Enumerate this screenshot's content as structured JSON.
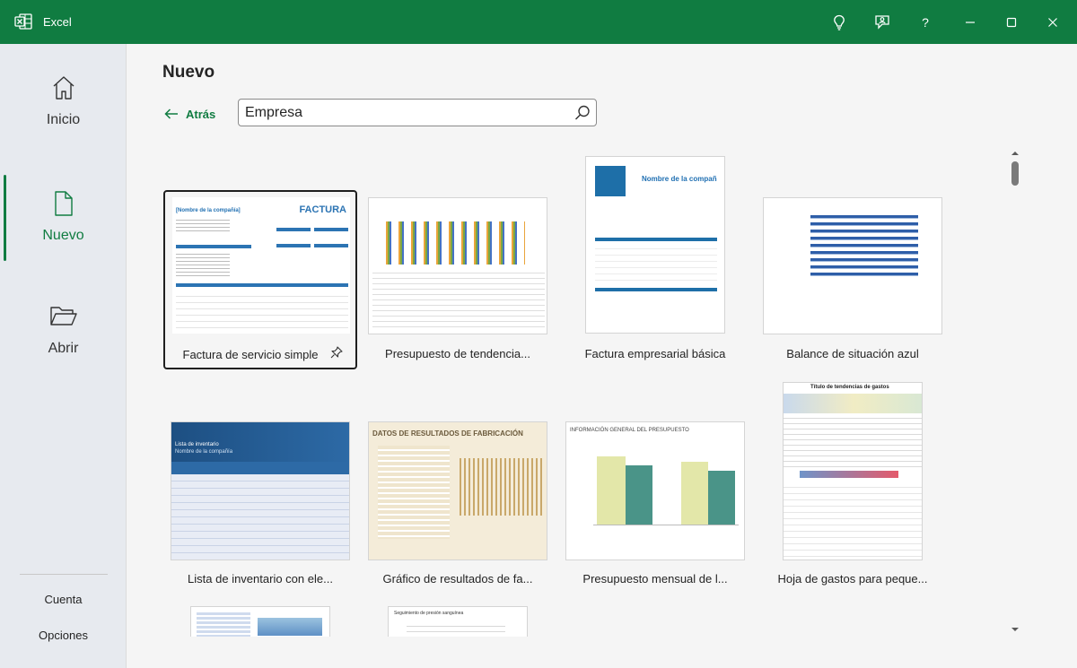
{
  "window": {
    "app_title": "Excel"
  },
  "titlebar": {
    "buttons": [
      "lightbulb-icon",
      "coauthor-icon",
      "help-icon",
      "minimize-icon",
      "maximize-icon",
      "close-icon"
    ],
    "help_label": "?"
  },
  "sidebar": {
    "items": [
      {
        "label": "Inicio",
        "icon": "home-icon"
      },
      {
        "label": "Nuevo",
        "icon": "new-document-icon",
        "active": true
      },
      {
        "label": "Abrir",
        "icon": "folder-open-icon"
      }
    ],
    "bottom": [
      {
        "label": "Cuenta"
      },
      {
        "label": "Opciones"
      }
    ]
  },
  "main": {
    "title": "Nuevo",
    "back_label": "Atrás",
    "search": {
      "value": "Empresa"
    }
  },
  "templates": [
    {
      "label": "Factura de servicio simple",
      "selected": true,
      "thumb_text": {
        "company": "[Nombre de la compañía]",
        "heading": "FACTURA"
      }
    },
    {
      "label": "Presupuesto de tendencia..."
    },
    {
      "label": "Factura empresarial básica",
      "thumb_text": {
        "heading": "Nombre de la compañ"
      }
    },
    {
      "label": "Balance de situación azul"
    },
    {
      "label": "Lista de inventario con ele...",
      "thumb_text": {
        "title": "Lista de inventario",
        "subtitle": "Nombre de la compañía"
      }
    },
    {
      "label": "Gráfico de resultados de fa...",
      "thumb_text": {
        "heading": "DATOS DE RESULTADOS DE FABRICACIÓN"
      }
    },
    {
      "label": "Presupuesto mensual de l...",
      "thumb_text": {
        "heading": "INFORMACIÓN GENERAL DEL PRESUPUESTO"
      }
    },
    {
      "label": "Hoja de gastos para peque...",
      "thumb_text": {
        "heading": "Título de tendencias de gastos"
      }
    },
    {
      "label": ""
    },
    {
      "label": "",
      "thumb_text": {
        "heading": "Seguimiento de presión sanguínea"
      }
    }
  ],
  "colors": {
    "accent": "#107c41",
    "titlebar": "#107c41",
    "sidebar": "#e7eaef"
  }
}
